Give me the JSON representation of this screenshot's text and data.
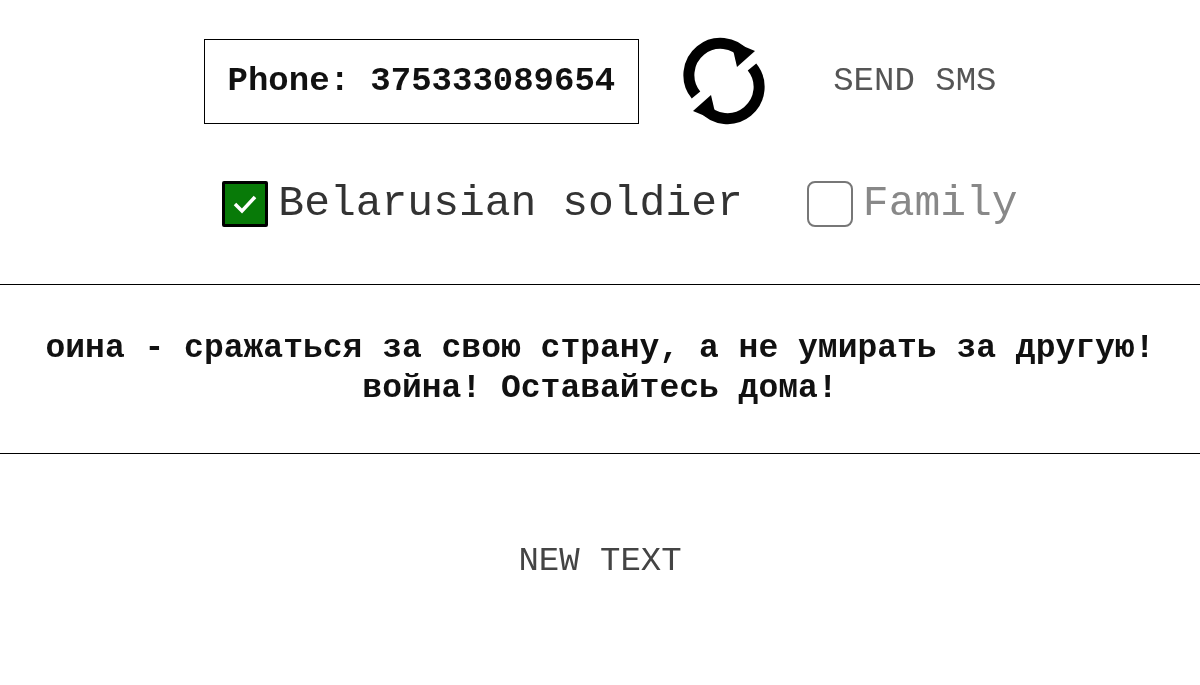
{
  "phone": {
    "label": "Phone: 375333089654"
  },
  "send_button": "SEND SMS",
  "options": [
    {
      "label": "Belarusian soldier",
      "checked": true
    },
    {
      "label": "Family",
      "checked": false
    }
  ],
  "message": {
    "lines": [
      "оина - сражаться за свою страну, а не умирать за другую!",
      "война! Оставайтесь дома!"
    ]
  },
  "new_text_button": "NEW TEXT"
}
